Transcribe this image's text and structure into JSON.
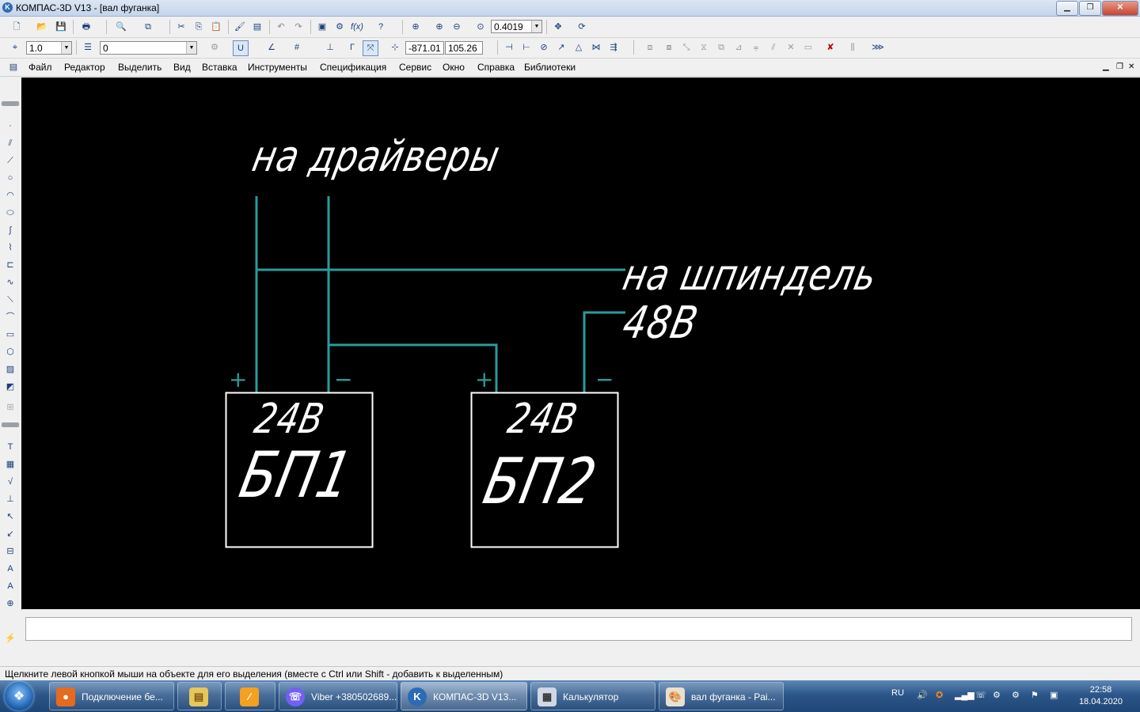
{
  "window": {
    "title": "КОМПАС-3D V13 - [вал фуганка]",
    "controls": [
      "minimize",
      "maximize",
      "close"
    ]
  },
  "toolbar1": {
    "zoom_value": "0.4019",
    "icons": [
      "new-icon",
      "open-icon",
      "save-icon",
      "print-icon",
      "preview-icon",
      "copy-props-icon",
      "cut-icon",
      "copy-icon",
      "paste-icon",
      "brush-icon",
      "doc-icon",
      "undo-icon",
      "redo-icon",
      "manager-icon",
      "variables-icon",
      "fx-icon",
      "help-icon",
      "zoom-window-icon",
      "zoom-in-icon",
      "zoom-out-icon",
      "zoom-scale-icon",
      "pan-icon",
      "refresh-icon"
    ]
  },
  "toolbar2": {
    "step_value": "1.0",
    "layer_value": "0",
    "coord_x": "-871.01",
    "coord_y": "105.26",
    "icons": [
      "snap-icon",
      "layer-icon",
      "grid-icon",
      "ortho-icon",
      "magnet-icon",
      "lcs-icon",
      "point-icon"
    ]
  },
  "menu": {
    "items": [
      "Файл",
      "Редактор",
      "Выделить",
      "Вид",
      "Вставка",
      "Инструменты",
      "Спецификация",
      "Сервис",
      "Окно",
      "Справка",
      "Библиотеки"
    ]
  },
  "drawing": {
    "label_drivers": "на драйверы",
    "label_spindle": "на шпиндель",
    "label_48v": "48В",
    "psu1": {
      "voltage": "24В",
      "name": "БП1"
    },
    "psu2": {
      "voltage": "24В",
      "name": "БП2"
    },
    "plus_sign": "+",
    "minus_sign": "−",
    "wire_color": "#2a9b9b",
    "box_color": "#ffffff",
    "background": "#000000"
  },
  "status": {
    "text": "Щелкните левой кнопкой мыши на объекте для его выделения (вместе с Ctrl или Shift - добавить к выделенным)"
  },
  "taskbar": {
    "tasks": [
      {
        "label": "Подключение бе...",
        "icon": "firefox-icon"
      },
      {
        "label": "",
        "icon": "explorer-icon"
      },
      {
        "label": "",
        "icon": "app-icon"
      },
      {
        "label": "Viber +380502689...",
        "icon": "viber-icon"
      },
      {
        "label": "КОМПАС-3D V13...",
        "icon": "kompas-icon",
        "active": true
      },
      {
        "label": "Калькулятор",
        "icon": "calculator-icon"
      },
      {
        "label": "вал фуганка - Pai...",
        "icon": "paint-icon"
      }
    ],
    "lang": "RU",
    "time": "22:58",
    "date": "18.04.2020"
  }
}
